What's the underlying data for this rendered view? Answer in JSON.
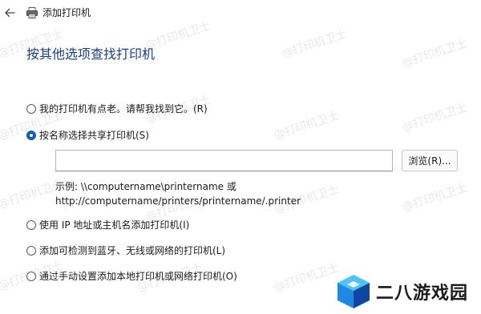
{
  "window": {
    "title": "添加打印机"
  },
  "heading": "按其他选项查找打印机",
  "options": [
    {
      "label": "我的打印机有点老。请帮我找到它。(R)",
      "checked": false
    },
    {
      "label": "按名称选择共享打印机(S)",
      "checked": true
    },
    {
      "label": "使用 IP 地址或主机名添加打印机(I)",
      "checked": false
    },
    {
      "label": "添加可检测到蓝牙、无线或网络的打印机(L)",
      "checked": false
    },
    {
      "label": "通过手动设置添加本地打印机或网络打印机(O)",
      "checked": false
    }
  ],
  "shared_printer": {
    "input_value": "",
    "browse_label": "浏览(R)...",
    "example_line1": "示例: \\\\computername\\printername 或",
    "example_line2": "http://computername/printers/printername/.printer"
  },
  "watermark": "@打印机卫士",
  "logo": {
    "text": "二八游戏园",
    "colors": [
      "#1e88e5",
      "#0d47a1",
      "#4fc3f7"
    ]
  },
  "icons": {
    "back": "back-arrow-icon",
    "printer": "printer-icon"
  },
  "colors": {
    "heading": "#1a3d8f",
    "radio_selected": "#0f5cc0"
  }
}
